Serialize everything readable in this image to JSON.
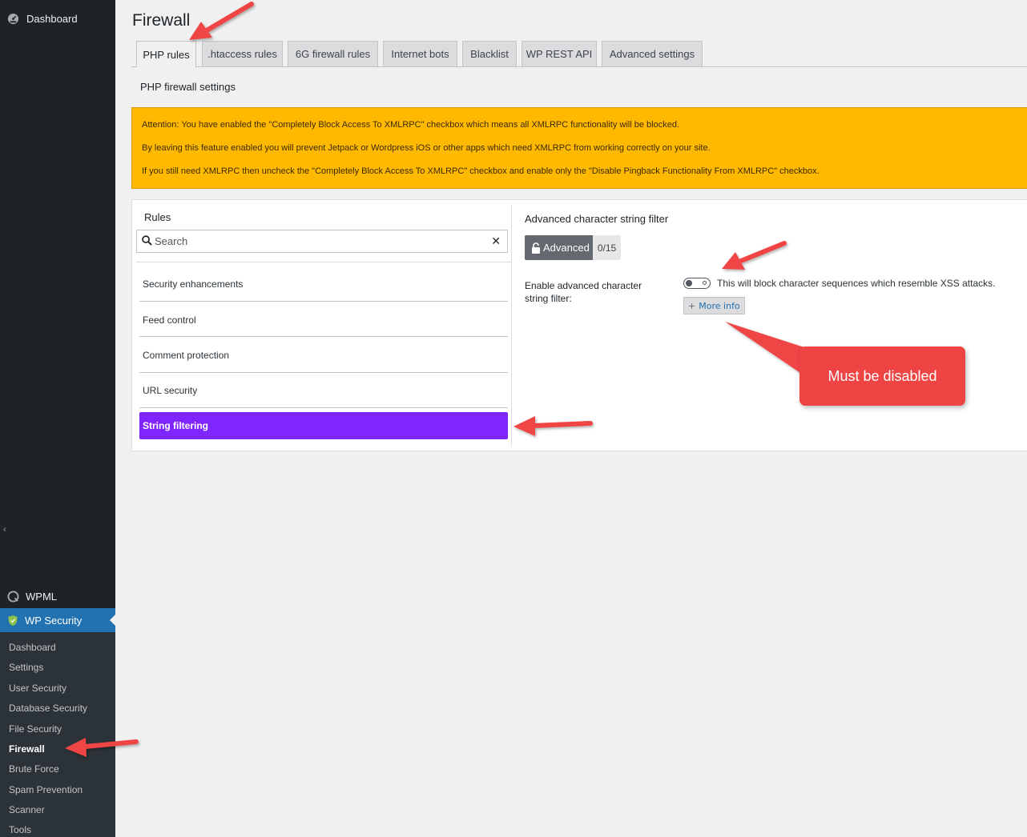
{
  "sidebar": {
    "top_item": "Dashboard",
    "collapse_glyph": "‹",
    "wpml": "WPML",
    "active_plugin": "WP Security",
    "submenu": [
      {
        "label": "Dashboard"
      },
      {
        "label": "Settings"
      },
      {
        "label": "User Security"
      },
      {
        "label": "Database Security"
      },
      {
        "label": "File Security"
      },
      {
        "label": "Firewall"
      },
      {
        "label": "Brute Force"
      },
      {
        "label": "Spam Prevention"
      },
      {
        "label": "Scanner"
      },
      {
        "label": "Tools"
      }
    ],
    "current": "Firewall"
  },
  "page": {
    "title": "Firewall"
  },
  "tabs": [
    {
      "label": "PHP rules"
    },
    {
      "label": ".htaccess rules"
    },
    {
      "label": "6G firewall rules"
    },
    {
      "label": "Internet bots"
    },
    {
      "label": "Blacklist"
    },
    {
      "label": "WP REST API"
    },
    {
      "label": "Advanced settings"
    }
  ],
  "active_tab": "PHP rules",
  "section_title": "PHP firewall settings",
  "notice": {
    "line1": "Attention: You have enabled the \"Completely Block Access To XMLRPC\" checkbox which means all XMLRPC functionality will be blocked.",
    "line2": "By leaving this feature enabled you will prevent Jetpack or Wordpress iOS or other apps which need XMLRPC from working correctly on your site.",
    "line3": "If you still need XMLRPC then uncheck the \"Completely Block Access To XMLRPC\" checkbox and enable only the \"Disable Pingback Functionality From XMLRPC\" checkbox."
  },
  "rules": {
    "title": "Rules",
    "search_placeholder": "Search",
    "clear_glyph": "✕",
    "items": [
      {
        "label": "Security enhancements"
      },
      {
        "label": "Feed control"
      },
      {
        "label": "Comment protection"
      },
      {
        "label": "URL security"
      },
      {
        "label": "String filtering"
      }
    ],
    "selected": "String filtering"
  },
  "filter": {
    "title": "Advanced character string filter",
    "badge_label": "Advanced",
    "badge_count": "0/15",
    "option_label": "Enable advanced character string filter:",
    "toggle_on": false,
    "toggle_desc": "This will block character sequences which resemble XSS attacks.",
    "more_info_plus": "+",
    "more_info": "More info"
  },
  "annotation": {
    "callout": "Must be disabled"
  },
  "colors": {
    "sidebar_bg": "#1d2327",
    "sidebar_active": "#2271b1",
    "notice_bg": "#ffb900",
    "selected_rule": "#7f26fd",
    "annotation_red": "#ef4444"
  }
}
